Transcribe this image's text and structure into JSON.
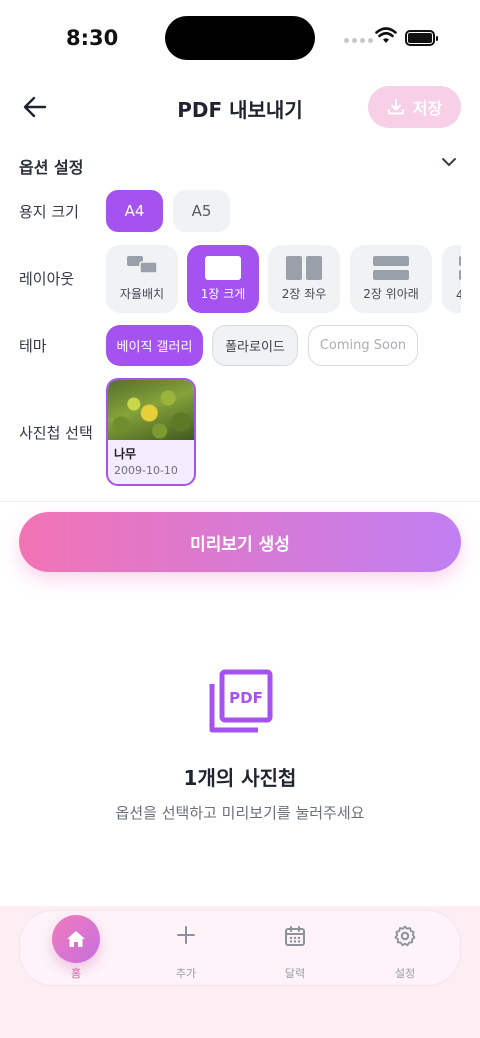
{
  "status_bar": {
    "time": "8:30"
  },
  "header": {
    "title": "PDF 내보내기",
    "save_label": "저장"
  },
  "options": {
    "title": "옵션 설정",
    "paper": {
      "label": "용지 크기",
      "options": [
        "A4",
        "A5"
      ],
      "selected": "A4"
    },
    "layout": {
      "label": "레이아웃",
      "items": [
        "자율배치",
        "1장 크게",
        "2장 좌우",
        "2장 위아래",
        "4"
      ],
      "selected": "1장 크게"
    },
    "theme": {
      "label": "테마",
      "items": [
        "베이직 갤러리",
        "폴라로이드",
        "Coming Soon"
      ],
      "selected": "베이직 갤러리"
    },
    "album": {
      "label": "사진첩 선택",
      "items": [
        {
          "name": "나무",
          "date": "2009-10-10"
        }
      ]
    }
  },
  "preview_button": "미리보기 생성",
  "empty_state": {
    "icon_text": "PDF",
    "title": "1개의 사진첩",
    "subtitle": "옵션을 선택하고 미리보기를 눌러주세요"
  },
  "tab_bar": [
    {
      "label": "홈",
      "active": true
    },
    {
      "label": "추가",
      "active": false
    },
    {
      "label": "달력",
      "active": false
    },
    {
      "label": "설정",
      "active": false
    }
  ],
  "colors": {
    "accent": "#a553f0",
    "pink": "#f174b4",
    "save_disabled": "#f7cfe6"
  }
}
